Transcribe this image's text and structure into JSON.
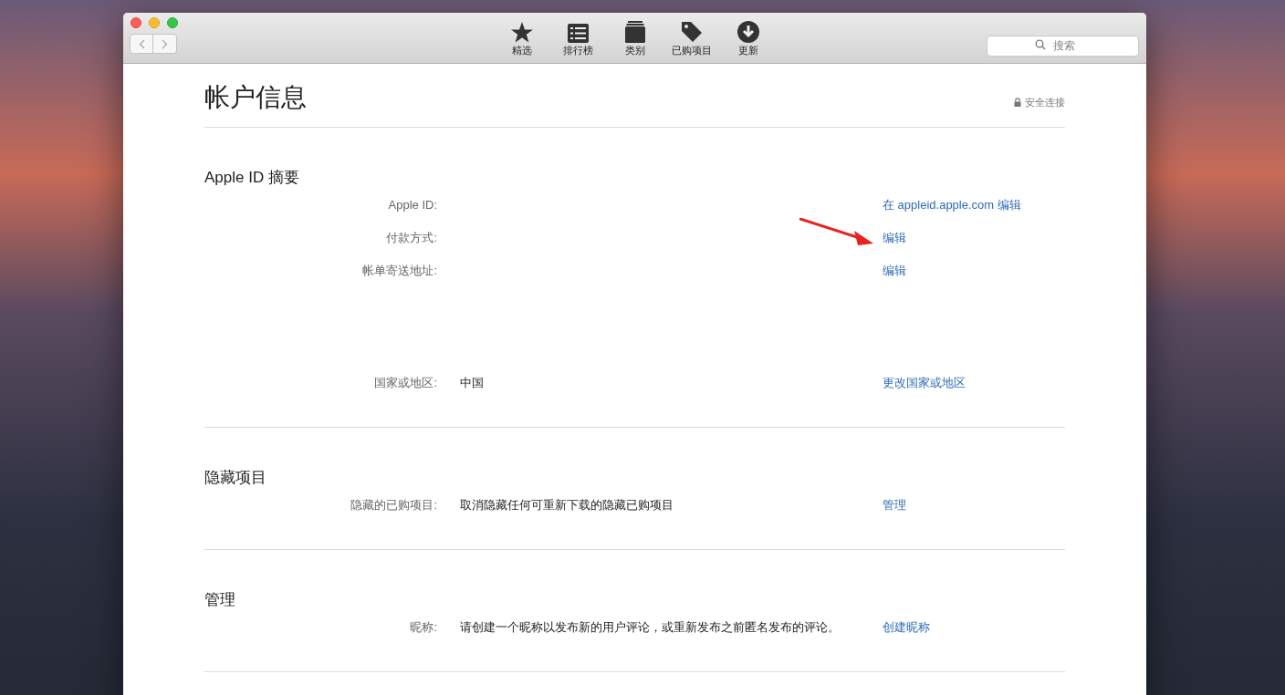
{
  "toolbar": {
    "items": [
      {
        "label": "精选",
        "kind": "star"
      },
      {
        "label": "排行榜",
        "kind": "list"
      },
      {
        "label": "类别",
        "kind": "stack"
      },
      {
        "label": "已购项目",
        "kind": "tag"
      },
      {
        "label": "更新",
        "kind": "download"
      }
    ],
    "search": {
      "placeholder": "搜索"
    }
  },
  "page": {
    "title": "帐户信息",
    "secure_label": "安全连接"
  },
  "sections": [
    {
      "heading": "Apple ID 摘要",
      "rows": [
        {
          "label": "Apple ID:",
          "value": "",
          "link": "在 appleid.apple.com 编辑",
          "kind": "plain"
        },
        {
          "label": "付款方式:",
          "value": "",
          "link": "编辑",
          "kind": "plain"
        },
        {
          "label": "帐单寄送地址:",
          "value": "",
          "link": "编辑",
          "kind": "address"
        },
        {
          "label": "国家或地区:",
          "value": "中国",
          "link": "更改国家或地区",
          "kind": "plain"
        }
      ]
    },
    {
      "heading": "隐藏项目",
      "rows": [
        {
          "label": "隐藏的已购项目:",
          "value": "取消隐藏任何可重新下载的隐藏已购项目",
          "link": "管理",
          "kind": "plain"
        }
      ]
    },
    {
      "heading": "管理",
      "rows": [
        {
          "label": "昵称:",
          "value": "请创建一个昵称以发布新的用户评论，或重新发布之前匿名发布的评论。",
          "link": "创建昵称",
          "kind": "plain"
        }
      ]
    }
  ]
}
